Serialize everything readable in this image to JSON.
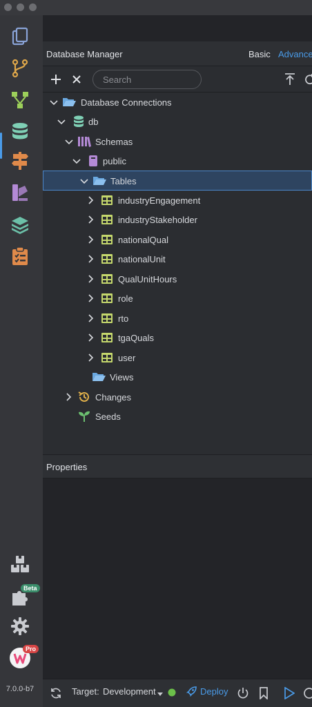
{
  "app": {
    "version": "7.0.0-b7"
  },
  "activity_bar": {
    "items": [
      {
        "name": "documents-icon"
      },
      {
        "name": "git-branch-icon"
      },
      {
        "name": "flow-icon"
      },
      {
        "name": "database-icon",
        "active": true
      },
      {
        "name": "signpost-icon"
      },
      {
        "name": "design-tools-icon"
      },
      {
        "name": "layers-icon"
      },
      {
        "name": "clipboard-checklist-icon"
      }
    ],
    "bottom_items": [
      {
        "name": "packages-icon"
      },
      {
        "name": "plugin-icon",
        "badge": "Beta"
      },
      {
        "name": "gear-icon"
      },
      {
        "name": "pro-logo-icon",
        "badge": "Pro"
      }
    ]
  },
  "header": {
    "title": "Database Manager",
    "basic_label": "Basic",
    "advanced_label": "Advanced"
  },
  "toolbar": {
    "search_placeholder": "Search"
  },
  "tree": {
    "root": "Database Connections",
    "db": "db",
    "schemas": "Schemas",
    "schema": "public",
    "tables_label": "Tables",
    "tables": [
      "industryEngagement",
      "industryStakeholder",
      "nationalQual",
      "nationalUnit",
      "QualUnitHours",
      "role",
      "rto",
      "tgaQuals",
      "user"
    ],
    "views": "Views",
    "changes": "Changes",
    "seeds": "Seeds"
  },
  "properties": {
    "title": "Properties"
  },
  "statusbar": {
    "target_label": "Target:",
    "target_value": "Development",
    "deploy_label": "Deploy"
  },
  "colors": {
    "accent": "#4a9be8",
    "table_icon": "#c5d86d",
    "folder": "#6aa8e0",
    "db_icon": "#7fd0b5",
    "schema_icon": "#b48ad6",
    "changes_icon": "#e0b04a",
    "seeds_icon": "#6cc070",
    "status_dot": "#6cc04a"
  }
}
